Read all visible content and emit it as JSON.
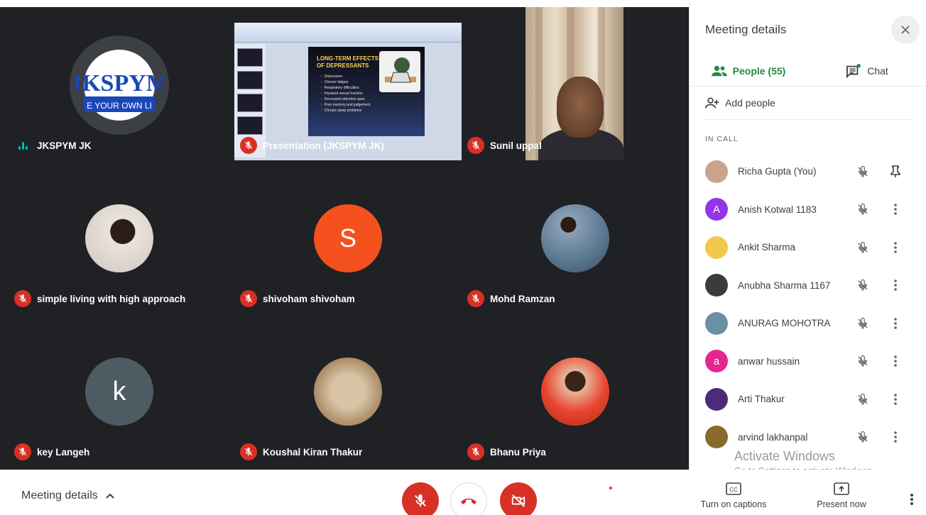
{
  "tiles": [
    {
      "name": "JKSPYM JK",
      "status": "speaking",
      "logo_text_top": "JKSPYM",
      "logo_text_bottom": "E YOUR OWN LI"
    },
    {
      "name": "Presentation (JKSPYM JK)",
      "status": "muted",
      "slide": {
        "title": "LONG-TERM EFFECTS OF DEPRESSANTS",
        "bullets": [
          "Depression",
          "Chronic fatigue",
          "Respiratory difficulties",
          "Impaired sexual function",
          "Decreased attention span",
          "Poor memory and judgement",
          "Chronic sleep problems"
        ]
      }
    },
    {
      "name": "Sunil uppal",
      "status": "muted"
    },
    {
      "name": "simple living with high approach",
      "status": "muted"
    },
    {
      "name": "shivoham shivoham",
      "status": "muted",
      "initial": "S"
    },
    {
      "name": "Mohd Ramzan",
      "status": "muted"
    },
    {
      "name": "key Langeh",
      "status": "muted",
      "initial": "k"
    },
    {
      "name": "Koushal Kiran Thakur",
      "status": "muted"
    },
    {
      "name": "Bhanu Priya",
      "status": "muted"
    }
  ],
  "sidebar": {
    "title": "Meeting details",
    "tabs": {
      "people": "People (55)",
      "chat": "Chat"
    },
    "add_people": "Add people",
    "section": "IN CALL",
    "people": [
      {
        "name": "Richa Gupta (You)",
        "initial": "",
        "color": "#c9a48a",
        "action": "pin"
      },
      {
        "name": "Anish Kotwal 1183",
        "initial": "A",
        "color": "#9334e6",
        "action": "more"
      },
      {
        "name": "Ankit Sharma",
        "initial": "",
        "color": "#f2c94c",
        "action": "more"
      },
      {
        "name": "Anubha Sharma 1167",
        "initial": "",
        "color": "#3b3b3b",
        "action": "more"
      },
      {
        "name": "ANURAG MOHOTRA",
        "initial": "",
        "color": "#6b8fa3",
        "action": "more"
      },
      {
        "name": "anwar hussain",
        "initial": "a",
        "color": "#e52592",
        "action": "more"
      },
      {
        "name": "Arti Thakur",
        "initial": "",
        "color": "#4a2c7a",
        "action": "more"
      },
      {
        "name": "arvind lakhanpal",
        "initial": "",
        "color": "#8a6a2a",
        "action": "more"
      }
    ]
  },
  "watermark": {
    "title": "Activate Windows",
    "subtitle": "Go to Settings to activate Windows."
  },
  "bottombar": {
    "meeting_details": "Meeting details",
    "captions": "Turn on captions",
    "present": "Present now"
  }
}
